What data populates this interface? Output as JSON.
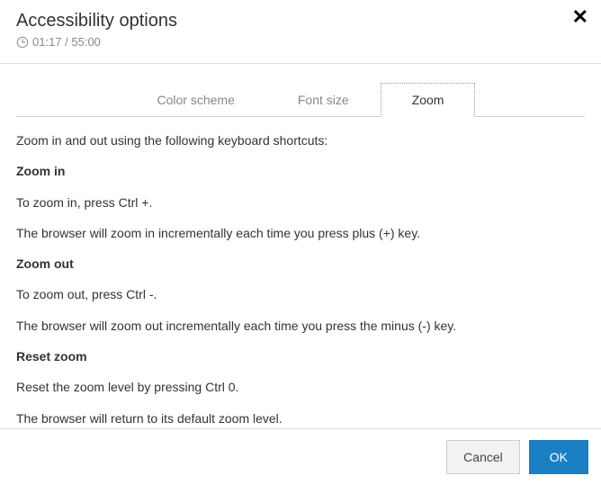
{
  "header": {
    "title": "Accessibility options",
    "timer": "01:17 / 55:00"
  },
  "tabs": [
    {
      "label": "Color scheme",
      "active": false
    },
    {
      "label": "Font size",
      "active": false
    },
    {
      "label": "Zoom",
      "active": true
    }
  ],
  "content": {
    "intro": "Zoom in and out using the following keyboard shortcuts:",
    "zoom_in_head": "Zoom in",
    "zoom_in_text": "To zoom in, press Ctrl +.",
    "zoom_in_note": "The browser will zoom in incrementally each time you press plus (+) key.",
    "zoom_out_head": "Zoom out",
    "zoom_out_text": "To zoom out, press Ctrl -.",
    "zoom_out_note": "The browser will zoom out incrementally each time you press the minus (-) key.",
    "reset_head": "Reset zoom",
    "reset_text": "Reset the zoom level by pressing Ctrl 0.",
    "reset_note": "The browser will return to its default zoom level."
  },
  "footer": {
    "cancel": "Cancel",
    "ok": "OK"
  }
}
